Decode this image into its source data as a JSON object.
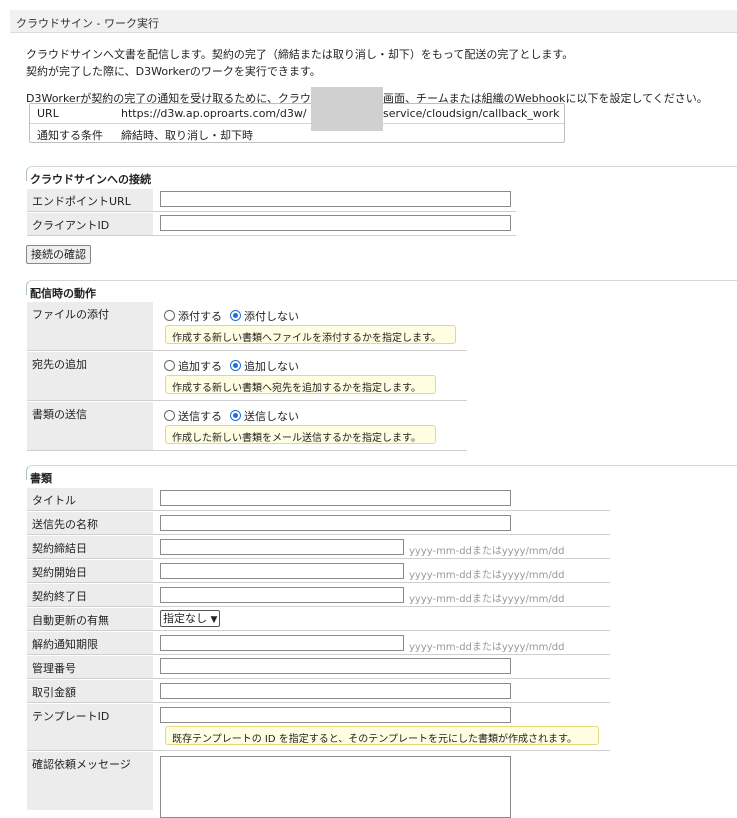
{
  "window": {
    "title": "クラウドサイン - ワーク実行"
  },
  "intro": {
    "line1": "クラウドサインへ文書を配信します。契約の完了（締結または取り消し・却下）をもって配送の完了とします。",
    "line2": "契約が完了した際に、D3Workerのワークを実行できます。",
    "line3_left": "D3Workerが契約の完了の通知を受け取るために、クラウド",
    "line3_right": "画面、チームまたは組織のWebhookに以下を設定してください。"
  },
  "webhook": {
    "url_key": "URL",
    "url_value_left": "https://d3w.ap.oproarts.com/d3w/",
    "url_value_right": "service/cloudsign/callback_work",
    "cond_key": "通知する条件",
    "cond_value": "締結時、取り消し・却下時"
  },
  "connection": {
    "heading": "クラウドサインへの接続",
    "endpoint_label": "エンドポイントURL",
    "client_label": "クライアントID",
    "check_button": "接続の確認"
  },
  "delivery": {
    "heading": "配信時の動作",
    "attach": {
      "label": "ファイルの添付",
      "opt1": "添付する",
      "opt2": "添付しない",
      "note": "作成する新しい書類へファイルを添付するかを指定します。"
    },
    "recipient": {
      "label": "宛先の追加",
      "opt1": "追加する",
      "opt2": "追加しない",
      "note": "作成する新しい書類へ宛先を追加するかを指定します。"
    },
    "send": {
      "label": "書類の送信",
      "opt1": "送信する",
      "opt2": "送信しない",
      "note": "作成した新しい書類をメール送信するかを指定します。"
    }
  },
  "document": {
    "heading": "書類",
    "title_label": "タイトル",
    "sender_label": "送信先の名称",
    "contract_date_label": "契約締結日",
    "start_date_label": "契約開始日",
    "end_date_label": "契約終了日",
    "auto_renew_label": "自動更新の有無",
    "auto_renew_value": "指定なし",
    "cancel_notice_label": "解約通知期限",
    "mgmt_no_label": "管理番号",
    "amount_label": "取引金額",
    "template_label": "テンプレートID",
    "template_note": "既存テンプレートの ID を指定すると、そのテンプレートを元にした書類が作成されます。",
    "message_label": "確認依頼メッセージ",
    "date_hint": "yyyy-mm-ddまたはyyyy/mm/dd"
  }
}
